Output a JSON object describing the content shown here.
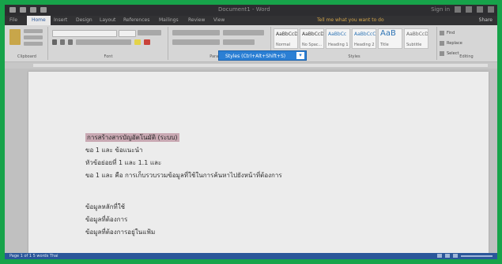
{
  "window": {
    "title": "Document1 - Word",
    "user": "Sign in",
    "share": "Share"
  },
  "tabs": [
    "File",
    "Home",
    "Insert",
    "Design",
    "Layout",
    "References",
    "Mailings",
    "Review",
    "View"
  ],
  "active_tab": "Home",
  "tell_me": "Tell me what you want to do",
  "ribbon": {
    "groups": [
      "Clipboard",
      "Font",
      "Paragraph",
      "Styles",
      "Editing"
    ],
    "styles": [
      {
        "sample": "AaBbCcDc",
        "name": "Normal"
      },
      {
        "sample": "AaBbCcDc",
        "name": "No Spac..."
      },
      {
        "sample": "AaBbCc",
        "name": "Heading 1"
      },
      {
        "sample": "AaBbCcC",
        "name": "Heading 2"
      },
      {
        "sample": "AaB",
        "name": "Title"
      },
      {
        "sample": "AaBbCcD",
        "name": "Subtitle"
      }
    ],
    "editing": [
      "Find",
      "Replace",
      "Select"
    ]
  },
  "tooltip": {
    "text": "Styles (Ctrl+Alt+Shift+S)",
    "arrow": "▾"
  },
  "document": {
    "lines": [
      "การสร้างสารบัญอัตโนมัติ (ระบบ)",
      "ขอ 1 และ ข้อแนะนำ",
      "หัวข้อย่อยที่ 1 และ 1.1 และ",
      "ขอ 1 และ คือ การเก็บรวบรวมข้อมูลที่ใช้ในการค้นหาไปยังหน้าที่ต้องการ",
      "ข้อมูลหลักที่ใช้",
      "ข้อมูลที่ต้องการ",
      "ข้อมูลที่ต้องการอยู่ในแฟ้ม"
    ]
  },
  "status": {
    "left": "Page 1 of 1   5 words   Thai"
  }
}
